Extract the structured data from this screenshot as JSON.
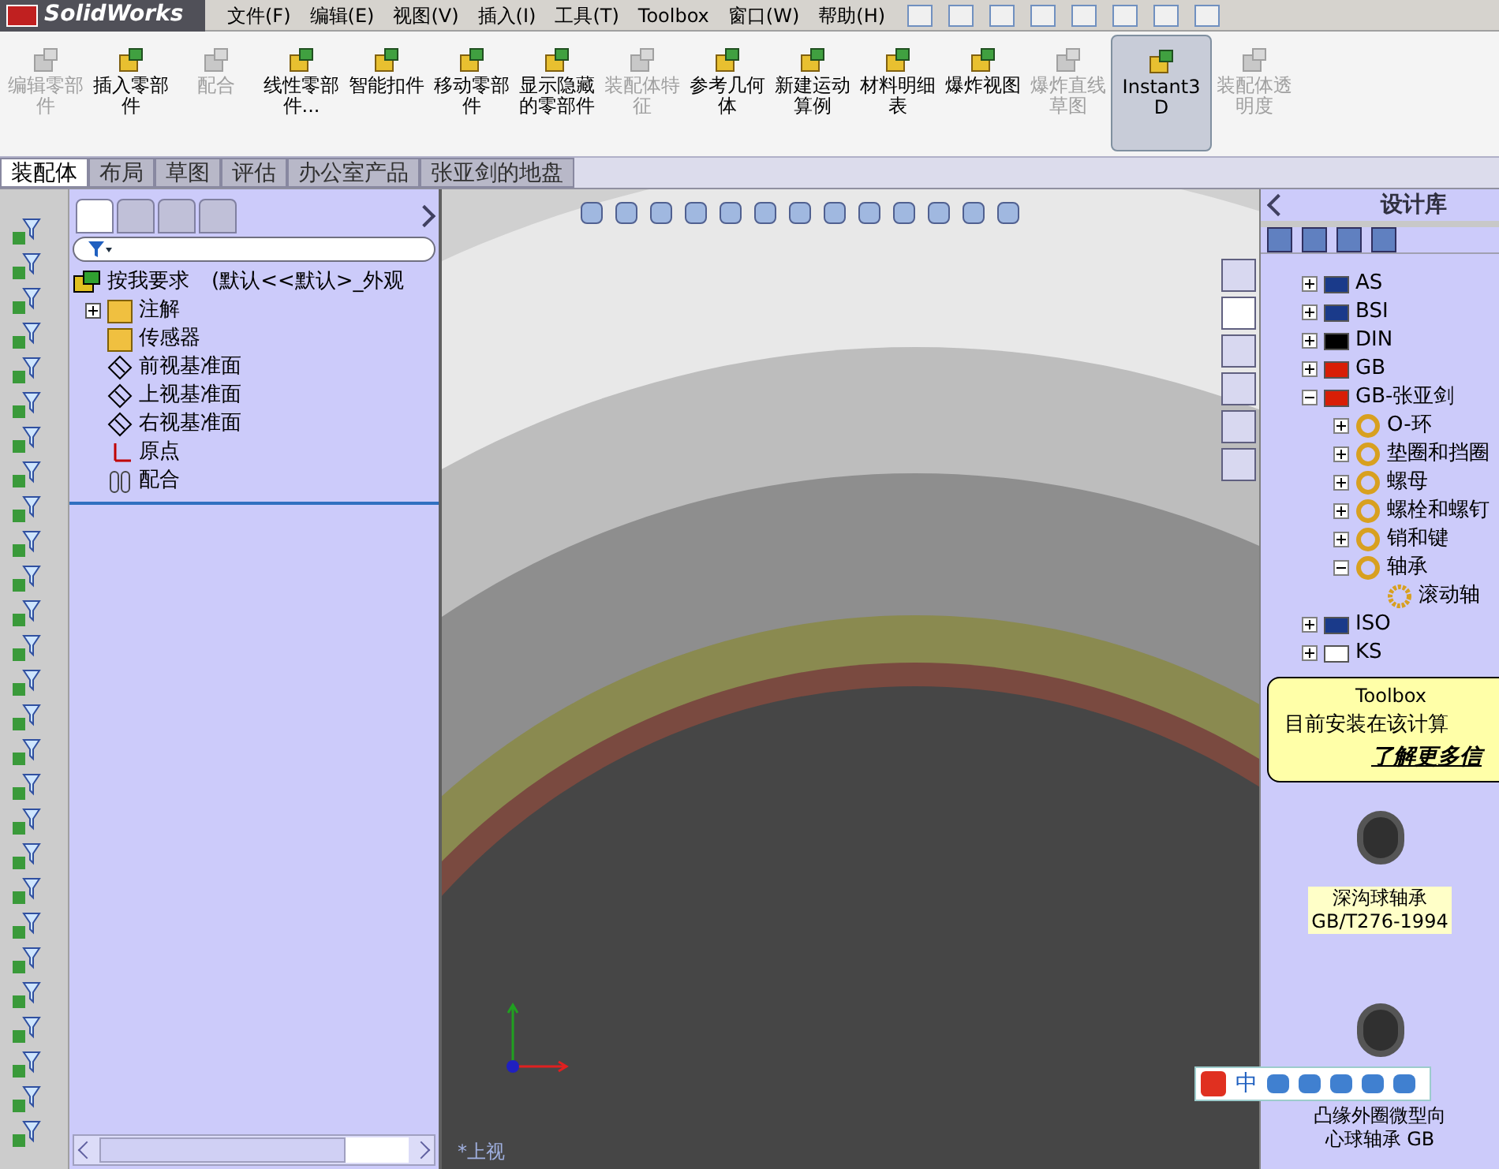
{
  "app": {
    "logo": "SolidWorks"
  },
  "menu": [
    {
      "label": "文件(F)"
    },
    {
      "label": "编辑(E)"
    },
    {
      "label": "视图(V)"
    },
    {
      "label": "插入(I)"
    },
    {
      "label": "工具(T)"
    },
    {
      "label": "Toolbox"
    },
    {
      "label": "窗口(W)"
    },
    {
      "label": "帮助(H)"
    }
  ],
  "ribbon": [
    {
      "label": "编辑零部件",
      "disabled": true,
      "selected": false
    },
    {
      "label": "插入零部件",
      "disabled": false,
      "selected": false
    },
    {
      "label": "配合",
      "disabled": true,
      "selected": false
    },
    {
      "label": "线性零部件...",
      "disabled": false,
      "selected": false
    },
    {
      "label": "智能扣件",
      "disabled": false,
      "selected": false
    },
    {
      "label": "移动零部件",
      "disabled": false,
      "selected": false
    },
    {
      "label": "显示隐藏的零部件",
      "disabled": false,
      "selected": false
    },
    {
      "label": "装配体特征",
      "disabled": true,
      "selected": false
    },
    {
      "label": "参考几何体",
      "disabled": false,
      "selected": false
    },
    {
      "label": "新建运动算例",
      "disabled": false,
      "selected": false
    },
    {
      "label": "材料明细表",
      "disabled": false,
      "selected": false
    },
    {
      "label": "爆炸视图",
      "disabled": false,
      "selected": false
    },
    {
      "label": "爆炸直线草图",
      "disabled": true,
      "selected": false
    },
    {
      "label": "Instant3D",
      "disabled": false,
      "selected": true
    },
    {
      "label": "装配体透明度",
      "disabled": true,
      "selected": false
    }
  ],
  "tabs": [
    {
      "label": "装配体",
      "selected": true
    },
    {
      "label": "布局",
      "selected": false
    },
    {
      "label": "草图",
      "selected": false
    },
    {
      "label": "评估",
      "selected": false
    },
    {
      "label": "办公室产品",
      "selected": false
    },
    {
      "label": "张亚剑的地盘",
      "selected": false
    }
  ],
  "feature_tree": {
    "root": "按我要求",
    "configuration": "(默认<<默认>_外观",
    "items": [
      {
        "label": "注解",
        "kind": "annotation"
      },
      {
        "label": "传感器",
        "kind": "sensor"
      },
      {
        "label": "前视基准面",
        "kind": "plane"
      },
      {
        "label": "上视基准面",
        "kind": "plane"
      },
      {
        "label": "右视基准面",
        "kind": "plane"
      },
      {
        "label": "原点",
        "kind": "origin"
      },
      {
        "label": "配合",
        "kind": "mate"
      }
    ]
  },
  "viewport": {
    "view_label": "*上视"
  },
  "design_library": {
    "title": "设计库",
    "tree": [
      {
        "label": "AS",
        "color": "#1a3a8a",
        "expanded": false
      },
      {
        "label": "BSI",
        "color": "#1a3a8a",
        "expanded": false
      },
      {
        "label": "DIN",
        "color": "#000000",
        "expanded": false
      },
      {
        "label": "GB",
        "color": "#d81e06",
        "expanded": false
      },
      {
        "label": "GB-张亚剑",
        "color": "#d81e06",
        "expanded": true,
        "children": [
          {
            "label": "O-环",
            "expanded": false
          },
          {
            "label": "垫圈和挡圈",
            "expanded": false
          },
          {
            "label": "螺母",
            "expanded": false
          },
          {
            "label": "螺栓和螺钉",
            "expanded": false
          },
          {
            "label": "销和键",
            "expanded": false
          },
          {
            "label": "轴承",
            "expanded": true,
            "children": [
              {
                "label": "滚动轴"
              }
            ]
          }
        ]
      },
      {
        "label": "ISO",
        "color": "#1a3a8a",
        "expanded": false
      },
      {
        "label": "KS",
        "color": "#ffffff",
        "expanded": false
      }
    ],
    "toolbox_note": {
      "title": "Toolbox",
      "text": "目前安装在该计算",
      "link": "了解更多信"
    },
    "previews": [
      {
        "lines": [
          "深沟球轴承",
          "GB/T276-1994"
        ]
      },
      {
        "lines": [
          "凸缘外圈微型向",
          "心球轴承 GB"
        ]
      }
    ]
  },
  "ime_bar": {
    "mode": "中"
  }
}
